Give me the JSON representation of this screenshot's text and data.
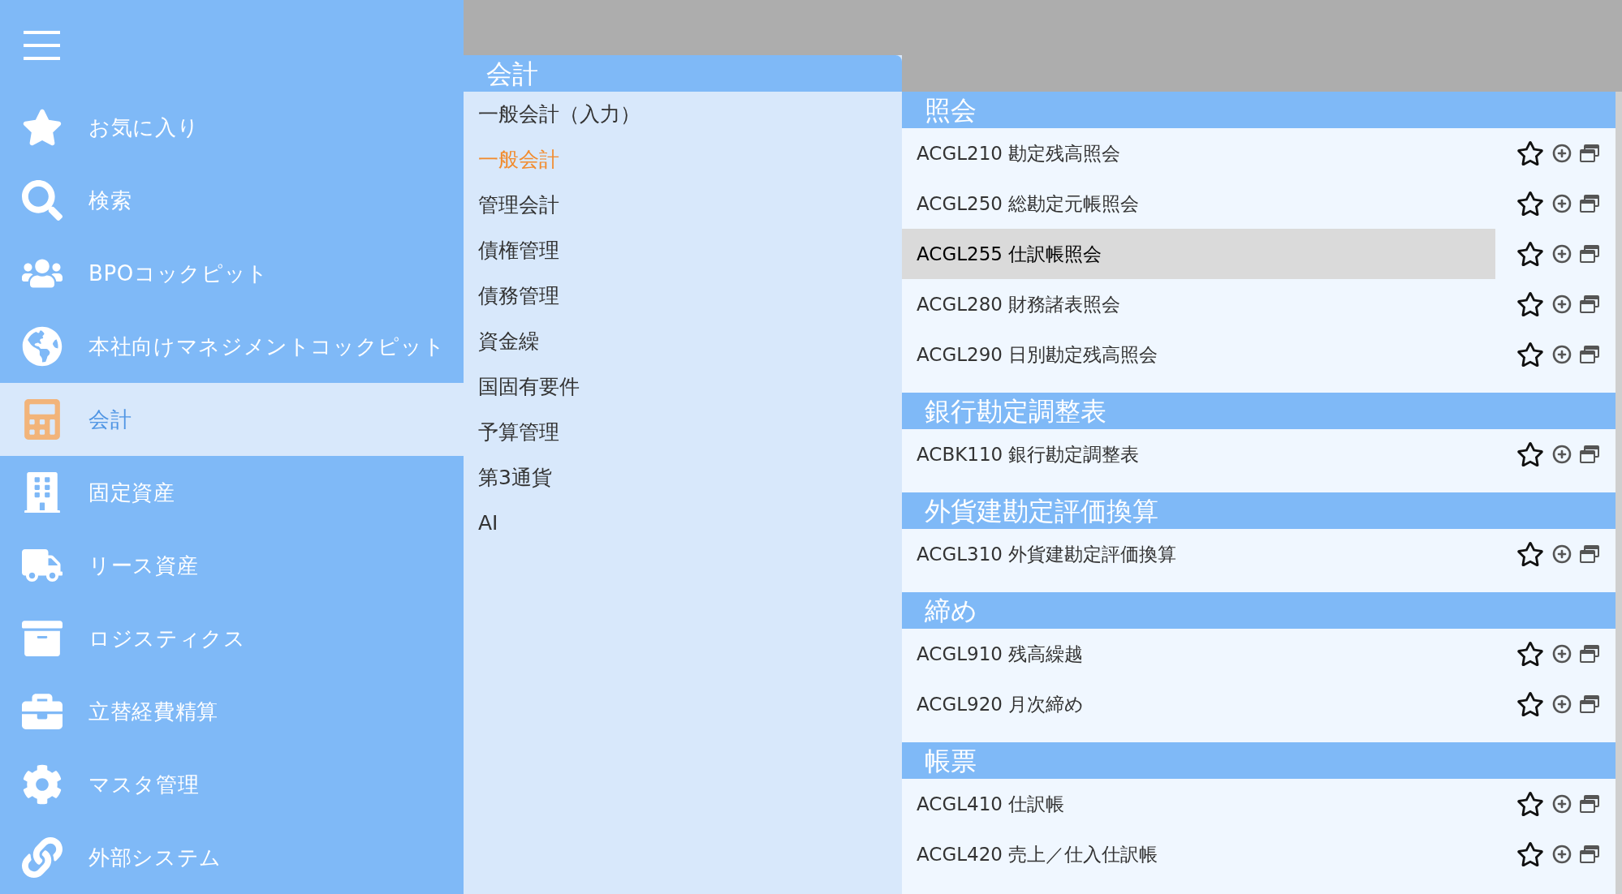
{
  "sidebar": {
    "items": [
      {
        "label": "お気に入り",
        "selected": false
      },
      {
        "label": "検索",
        "selected": false
      },
      {
        "label": "BPOコックピット",
        "selected": false
      },
      {
        "label": "本社向けマネジメントコックピット",
        "selected": false
      },
      {
        "label": "会計",
        "selected": true
      },
      {
        "label": "固定資産",
        "selected": false
      },
      {
        "label": "リース資産",
        "selected": false
      },
      {
        "label": "ロジスティクス",
        "selected": false
      },
      {
        "label": "立替経費精算",
        "selected": false
      },
      {
        "label": "マスタ管理",
        "selected": false
      },
      {
        "label": "外部システム",
        "selected": false
      }
    ]
  },
  "submenu": {
    "title": "会計",
    "items": [
      {
        "label": "一般会計（入力）",
        "selected": false
      },
      {
        "label": "一般会計",
        "selected": true
      },
      {
        "label": "管理会計",
        "selected": false
      },
      {
        "label": "債権管理",
        "selected": false
      },
      {
        "label": "債務管理",
        "selected": false
      },
      {
        "label": "資金繰",
        "selected": false
      },
      {
        "label": "国固有要件",
        "selected": false
      },
      {
        "label": "予算管理",
        "selected": false
      },
      {
        "label": "第3通貨",
        "selected": false
      },
      {
        "label": "AI",
        "selected": false
      }
    ]
  },
  "sections": [
    {
      "title": "照会",
      "rows": [
        {
          "label": "ACGL210 勘定残高照会",
          "selected": false
        },
        {
          "label": "ACGL250 総勘定元帳照会",
          "selected": false
        },
        {
          "label": "ACGL255 仕訳帳照会",
          "selected": true
        },
        {
          "label": "ACGL280 財務諸表照会",
          "selected": false
        },
        {
          "label": "ACGL290 日別勘定残高照会",
          "selected": false
        }
      ]
    },
    {
      "title": "銀行勘定調整表",
      "rows": [
        {
          "label": "ACBK110 銀行勘定調整表",
          "selected": false
        }
      ]
    },
    {
      "title": "外貨建勘定評価換算",
      "rows": [
        {
          "label": "ACGL310 外貨建勘定評価換算",
          "selected": false
        }
      ]
    },
    {
      "title": "締め",
      "rows": [
        {
          "label": "ACGL910 残高繰越",
          "selected": false
        },
        {
          "label": "ACGL920 月次締め",
          "selected": false
        }
      ]
    },
    {
      "title": "帳票",
      "rows": [
        {
          "label": "ACGL410 仕訳帳",
          "selected": false
        },
        {
          "label": "ACGL420 売上／仕入仕訳帳",
          "selected": false
        }
      ]
    }
  ]
}
